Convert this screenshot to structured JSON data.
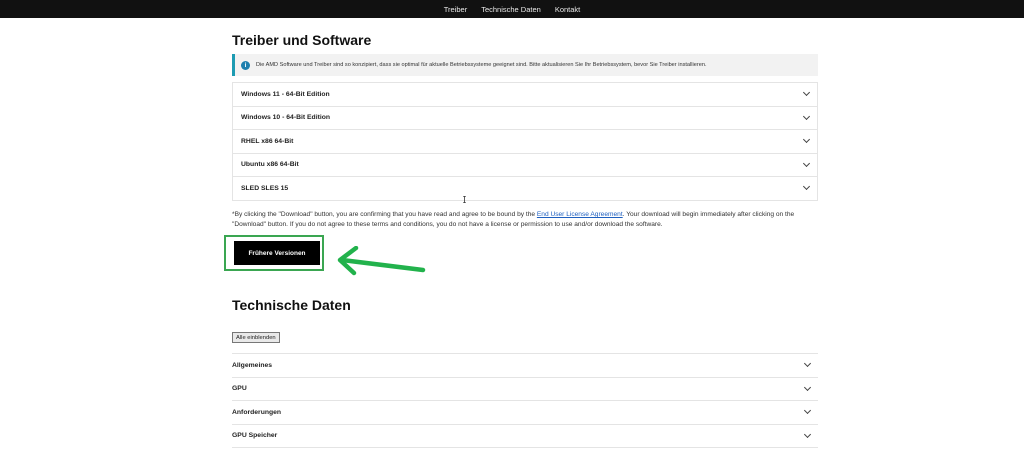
{
  "topnav": {
    "items": [
      "Treiber",
      "Technische Daten",
      "Kontakt"
    ]
  },
  "drivers": {
    "title": "Treiber und Software",
    "notice": "Die AMD Software und Treiber sind so konzipiert, dass sie optimal für aktuelle Betriebssysteme geeignet sind. Bitte aktualisieren Sie Ihr Betriebssystem, bevor Sie Treiber installieren.",
    "os_list": [
      "Windows 11 - 64-Bit Edition",
      "Windows 10 - 64-Bit Edition",
      "RHEL x86 64-Bit",
      "Ubuntu x86 64-Bit",
      "SLED SLES 15"
    ],
    "disclaimer_before": "*By clicking the \"Download\" button, you are confirming that you have read and agree to be bound by the ",
    "disclaimer_link": "End User License Agreement",
    "disclaimer_after": ". Your download will begin immediately after clicking on the \"Download\" button. If you do not agree to these terms and conditions, you do not have a license or permission to use and/or download the software.",
    "previous_versions_button": "Frühere Versionen"
  },
  "specs": {
    "title": "Technische Daten",
    "show_all_button": "Alle einblenden",
    "sections": [
      "Allgemeines",
      "GPU",
      "Anforderungen",
      "GPU Speicher"
    ]
  },
  "colors": {
    "accent_highlight": "#3aa651",
    "info": "#1d7fae",
    "link": "#1e5fbf",
    "nav_bg": "#111111"
  }
}
